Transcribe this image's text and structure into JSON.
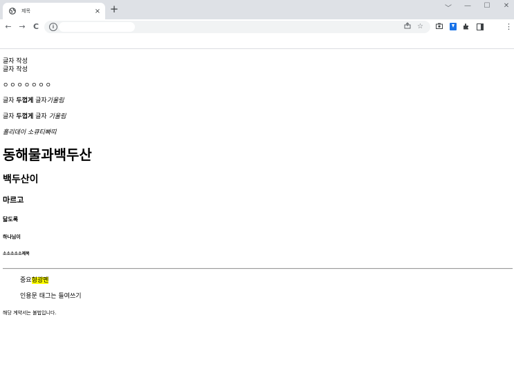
{
  "browser": {
    "tab_title": "제목",
    "tab_close": "×",
    "new_tab": "+",
    "window_controls": [
      "﹀",
      "—",
      "☐",
      "✕"
    ],
    "nav": {
      "back": "←",
      "forward": "→",
      "reload": "C"
    },
    "omnibox_info": "i",
    "icons": {
      "share": "share-icon",
      "star": "star-icon",
      "camera": "camera-icon",
      "download": "download-icon",
      "puzzle": "extensions-icon",
      "sidepanel": "side-panel-icon",
      "menu": "menu-icon"
    },
    "accent_color": "#1a73e8"
  },
  "page": {
    "line1": "글자 작성",
    "line2": "글자 작성",
    "circles": "ㅇㅇㅇㅇㅇㅇㅇ",
    "bold_line": {
      "a": "글자 ",
      "b": "두껍게",
      "c": " 글자",
      "d": "기울림"
    },
    "strong_line": {
      "a": "글자 ",
      "b": "두껍게",
      "c": " 글자 ",
      "d": "기울림"
    },
    "italic_line": "홀리데이 소큐티빠띠",
    "h1": "동해물과백두산",
    "h2": "백두산이",
    "h3": "마르고",
    "h4": "닳도록",
    "h5": "하나님이",
    "h6": "소소소소소제목",
    "quote1_plain": "중요",
    "quote1_mark": "형광펜",
    "highlight_color": "#ffff00",
    "quote2": "인용문 태그는 들여쓰기",
    "small": "해당 계약서는 불법입니다."
  }
}
